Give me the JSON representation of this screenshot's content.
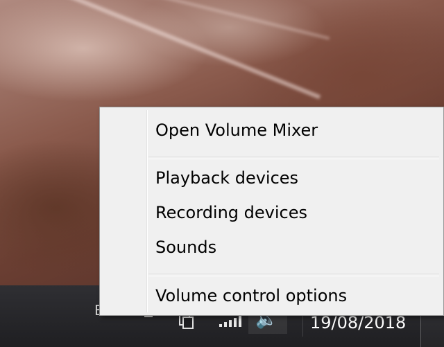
{
  "context_menu": {
    "items": [
      {
        "label": "Open Volume Mixer"
      },
      {
        "label": "Playback devices"
      },
      {
        "label": "Recording devices"
      },
      {
        "label": "Sounds"
      },
      {
        "label": "Volume control options"
      }
    ]
  },
  "taskbar": {
    "clock_date": "19/08/2018",
    "tray_partial_glyph": "E",
    "icons": [
      "flag-icon",
      "clipboard-icon",
      "network-signal-icon",
      "speaker-icon"
    ]
  }
}
